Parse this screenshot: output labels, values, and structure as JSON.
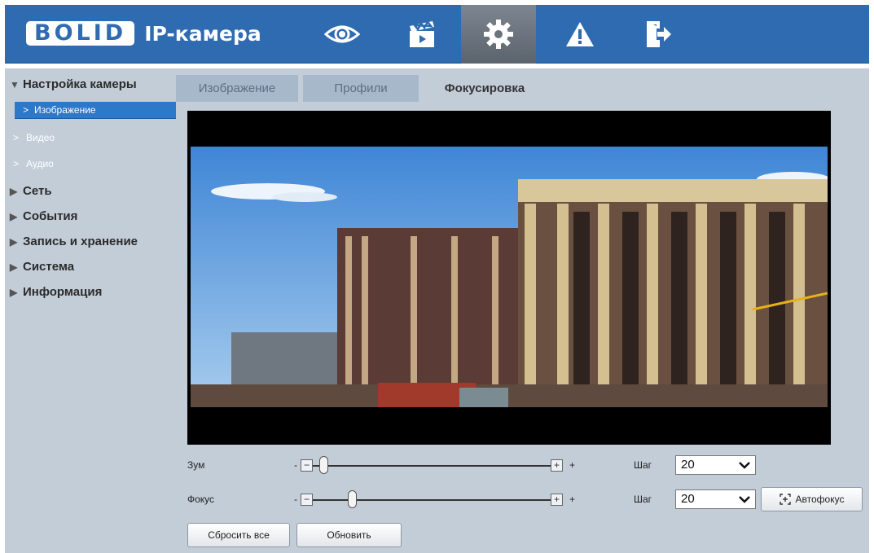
{
  "header": {
    "logo_text": "BOLID",
    "app_title": "IP-камера",
    "nav": [
      {
        "icon": "eye-icon"
      },
      {
        "icon": "clapperboard-icon"
      },
      {
        "icon": "gear-icon",
        "active": true
      },
      {
        "icon": "warning-icon"
      },
      {
        "icon": "logout-icon"
      }
    ]
  },
  "sidebar": {
    "camera_setup": "Настройка камеры",
    "items": [
      {
        "label": "Изображение",
        "active": true
      },
      {
        "label": "Видео"
      },
      {
        "label": "Аудио"
      }
    ],
    "sections": [
      "Сеть",
      "События",
      "Запись и хранение",
      "Система",
      "Информация"
    ]
  },
  "tabs": [
    {
      "label": "Изображение"
    },
    {
      "label": "Профили"
    },
    {
      "label": "Фокусировка",
      "active": true
    }
  ],
  "controls": {
    "zoom": {
      "label": "Зум",
      "minus": "-",
      "plus": "+",
      "step_label": "Шаг",
      "step_value": "20",
      "position": 0.0
    },
    "focus": {
      "label": "Фокус",
      "minus": "-",
      "plus": "+",
      "step_label": "Шаг",
      "step_value": "20",
      "position": 0.13
    },
    "autofocus_label": "Автофокус",
    "reset_all_label": "Сбросить все",
    "refresh_label": "Обновить"
  }
}
